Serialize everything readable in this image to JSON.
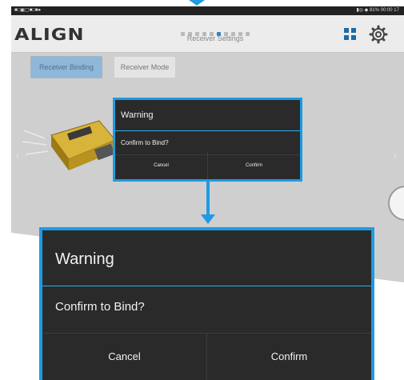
{
  "status_bar": {
    "left": "■□▣▢■□■●",
    "right": "▮◎ ◆ 81% 00:00 17"
  },
  "app": {
    "logo": "ALIGN",
    "page_title": "Receiver Settings",
    "page_indicator": {
      "total": 10,
      "active_index": 5
    }
  },
  "tabs": [
    {
      "label": "Receiver Binding",
      "active": true
    },
    {
      "label": "Receiver Mode",
      "active": false
    }
  ],
  "dialog": {
    "title": "Warning",
    "message": "Confirm to Bind?",
    "cancel_label": "Cancel",
    "confirm_label": "Confirm"
  },
  "colors": {
    "accent": "#1e9be3",
    "dialog_bg": "#2a2a2a",
    "active_tab": "#8fb7d8",
    "icon_blue": "#1c6aa8"
  },
  "icons": [
    "grid-icon",
    "gear-icon",
    "receiver-image",
    "chevron-left-icon",
    "chevron-right-icon"
  ]
}
